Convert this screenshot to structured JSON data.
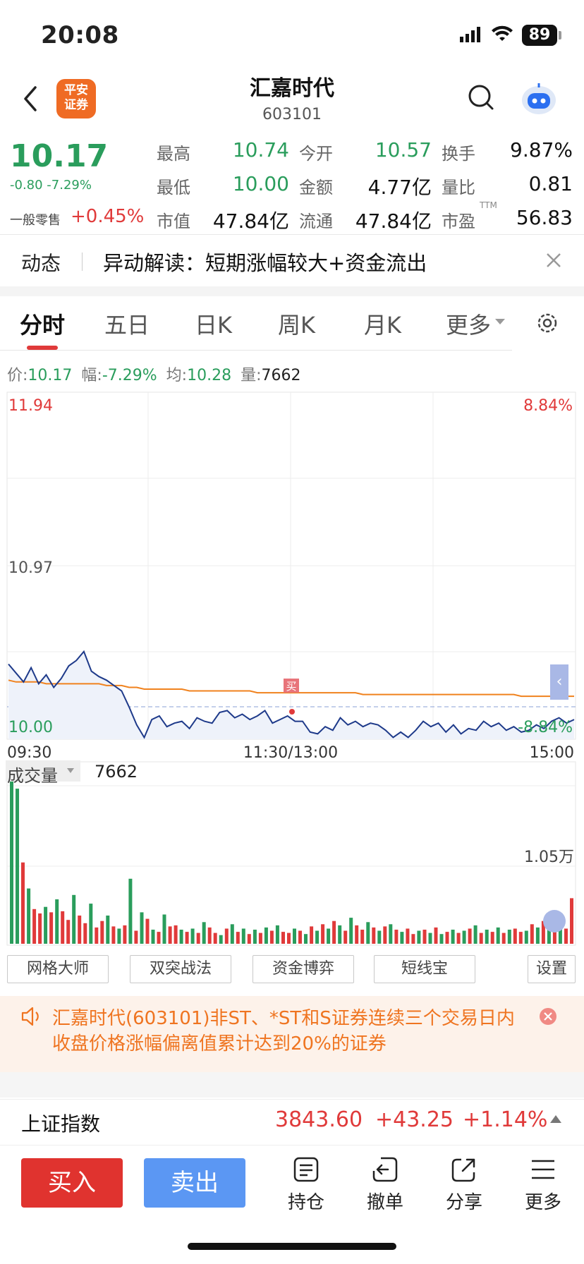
{
  "status": {
    "time": "20:08",
    "battery": "89"
  },
  "header": {
    "logo_line1": "平安",
    "logo_line2": "证券",
    "name": "汇嘉时代",
    "code": "603101"
  },
  "quote": {
    "price": "10.17",
    "change": "-0.80 -7.29%",
    "odd_lot_label": "一般零售",
    "odd_lot_value": "+0.45%",
    "high_label": "最高",
    "high": "10.74",
    "open_label": "今开",
    "open": "10.57",
    "turnover_label": "换手",
    "turnover": "9.87%",
    "low_label": "最低",
    "low": "10.00",
    "amount_label": "金额",
    "amount": "4.77亿",
    "vol_ratio_label": "量比",
    "vol_ratio": "0.81",
    "mcap_label": "市值",
    "mcap": "47.84亿",
    "float_label": "流通",
    "float": "47.84亿",
    "pe_label": "市盈",
    "pe_sup": "TTM",
    "pe": "56.83"
  },
  "news": {
    "tag": "动态",
    "text": "异动解读：短期涨幅较大+资金流出"
  },
  "tabs": [
    "分时",
    "五日",
    "日K",
    "周K",
    "月K",
    "更多"
  ],
  "info": {
    "price_label": "价:",
    "price": "10.17",
    "range_label": "幅:",
    "range": "-7.29%",
    "avg_label": "均:",
    "avg": "10.28",
    "vol_label": "量:",
    "vol": "7662"
  },
  "chart_data": {
    "type": "line",
    "y_axis_left": {
      "top": "11.94",
      "mid": "10.97",
      "bottom": "10.00"
    },
    "y_axis_right": {
      "top": "8.84%",
      "bottom": "-8.84%"
    },
    "x_ticks": [
      "09:30",
      "11:30/13:00",
      "15:00"
    ],
    "buy_marker": "买",
    "series": [
      {
        "name": "价",
        "color": "#1e3a8a",
        "values": [
          10.42,
          10.37,
          10.32,
          10.4,
          10.31,
          10.36,
          10.29,
          10.34,
          10.41,
          10.44,
          10.49,
          10.38,
          10.35,
          10.33,
          10.3,
          10.27,
          10.18,
          10.08,
          10.01,
          10.11,
          10.13,
          10.07,
          10.09,
          10.1,
          10.06,
          10.12,
          10.1,
          10.09,
          10.15,
          10.16,
          10.12,
          10.14,
          10.11,
          10.13,
          10.16,
          10.09,
          10.11,
          10.13,
          10.1,
          10.1,
          10.04,
          10.03,
          10.07,
          10.05,
          10.12,
          10.08,
          10.1,
          10.07,
          10.09,
          10.08,
          10.05,
          10.01,
          10.04,
          10.01,
          10.05,
          10.1,
          10.07,
          10.09,
          10.04,
          10.08,
          10.03,
          10.06,
          10.05,
          10.1,
          10.07,
          10.09,
          10.05,
          10.07,
          10.04,
          10.05,
          10.08,
          10.06,
          10.1,
          10.12,
          10.09,
          10.11
        ]
      },
      {
        "name": "均",
        "color": "#f0821e",
        "values": [
          10.33,
          10.32,
          10.32,
          10.32,
          10.32,
          10.31,
          10.31,
          10.31,
          10.31,
          10.31,
          10.31,
          10.31,
          10.31,
          10.3,
          10.3,
          10.3,
          10.29,
          10.29,
          10.28,
          10.28,
          10.28,
          10.28,
          10.28,
          10.28,
          10.27,
          10.27,
          10.27,
          10.27,
          10.27,
          10.27,
          10.27,
          10.27,
          10.27,
          10.26,
          10.26,
          10.26,
          10.26,
          10.26,
          10.26,
          10.26,
          10.26,
          10.26,
          10.26,
          10.26,
          10.26,
          10.26,
          10.26,
          10.25,
          10.25,
          10.25,
          10.25,
          10.25,
          10.25,
          10.25,
          10.25,
          10.25,
          10.25,
          10.25,
          10.25,
          10.25,
          10.25,
          10.25,
          10.25,
          10.25,
          10.25,
          10.25,
          10.25,
          10.25,
          10.24,
          10.24,
          10.24,
          10.24,
          10.24,
          10.24,
          10.24,
          10.24
        ]
      }
    ],
    "ylim": [
      10.0,
      11.94
    ],
    "volume": {
      "label": "成交量",
      "value": "7662",
      "axis_label": "1.05万",
      "ymax": 16000,
      "bars": [
        16000,
        14300,
        7500,
        5100,
        3200,
        2800,
        3400,
        2900,
        4100,
        3000,
        2200,
        4500,
        2600,
        1900,
        3700,
        1500,
        2100,
        2600,
        1600,
        1400,
        1700,
        6000,
        1200,
        2900,
        2300,
        1300,
        1100,
        2700,
        1600,
        1700,
        1300,
        1100,
        1400,
        1000,
        2000,
        1500,
        1000,
        800,
        1400,
        1800,
        1100,
        1400,
        900,
        1300,
        1000,
        1500,
        1200,
        1700,
        1100,
        1000,
        1400,
        1200,
        900,
        1600,
        1200,
        1800,
        1400,
        2100,
        1700,
        1200,
        2400,
        1700,
        1300,
        2000,
        1500,
        1200,
        1600,
        1800,
        1300,
        1100,
        1400,
        900,
        1200,
        1300,
        1000,
        1500,
        900,
        1100,
        1300,
        1000,
        1200,
        1400,
        1700,
        1000,
        1300,
        1100,
        1500,
        1000,
        1300,
        1400,
        1100,
        1200,
        1800,
        1500,
        2100,
        1800,
        3000,
        2200,
        1400,
        4200
      ],
      "colors": [
        "g",
        "g",
        "r",
        "g",
        "r",
        "r",
        "g",
        "r",
        "g",
        "r",
        "r",
        "g",
        "r",
        "r",
        "g",
        "r",
        "r",
        "g",
        "r",
        "g",
        "r",
        "g",
        "r",
        "g",
        "r",
        "g",
        "r",
        "g",
        "r",
        "r",
        "g",
        "r",
        "g",
        "r",
        "g",
        "r",
        "r",
        "g",
        "r",
        "g",
        "r",
        "g",
        "r",
        "g",
        "r",
        "g",
        "r",
        "g",
        "r",
        "r",
        "g",
        "r",
        "g",
        "r",
        "g",
        "r",
        "g",
        "r",
        "g",
        "r",
        "g",
        "r",
        "r",
        "g",
        "r",
        "g",
        "r",
        "g",
        "r",
        "g",
        "r",
        "r",
        "g",
        "r",
        "g",
        "r",
        "g",
        "r",
        "g",
        "r",
        "g",
        "r",
        "g",
        "r",
        "g",
        "r",
        "g",
        "r",
        "g",
        "r",
        "r",
        "g",
        "r",
        "g",
        "r",
        "g",
        "r",
        "g",
        "r",
        "r"
      ]
    }
  },
  "tools": [
    "网格大师",
    "双突战法",
    "资金博弈",
    "短线宝",
    "设置"
  ],
  "warning": {
    "line1": "汇嘉时代(603101)非ST、*ST和S证券连续三个交易日内",
    "line2": "收盘价格涨幅偏离值累计达到20%的证券"
  },
  "index": {
    "name": "上证指数",
    "price": "3843.60",
    "change": "+43.25",
    "pct": "+1.14%"
  },
  "bottom": {
    "buy": "买入",
    "sell": "卖出",
    "hold": "持仓",
    "cancel": "撤单",
    "share": "分享",
    "more": "更多"
  },
  "colors": {
    "up": "#e03a3a",
    "down": "#2a9d5c",
    "price_line": "#1e3a8a",
    "avg_line": "#f0821e",
    "accent": "#ef6b24"
  }
}
